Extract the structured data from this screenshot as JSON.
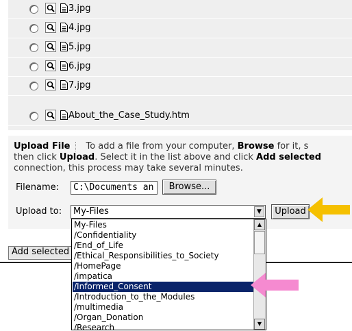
{
  "files": [
    {
      "name": "3.jpg"
    },
    {
      "name": "4.jpg"
    },
    {
      "name": "5.jpg"
    },
    {
      "name": "6.jpg"
    },
    {
      "name": "7.jpg"
    },
    {
      "name": "About_the_Case_Study.htm"
    }
  ],
  "upload": {
    "title": "Upload File",
    "help_line1_text": "To add a file from your computer,",
    "help_browse": "Browse",
    "help_line1_tail": "for it, s",
    "help_line2_lead": "then click",
    "help_upload": "Upload",
    "help_line2_mid": ". Select it in the list above and click",
    "help_add_selected": "Add selected",
    "help_line3": "connection, this process may take several minutes.",
    "filename_label": "Filename:",
    "filename_value": "C:\\Documents an",
    "browse_button": "Browse...",
    "upload_to_label": "Upload to:",
    "upload_to_value": "My-Files",
    "upload_button": "Upload"
  },
  "dropdown": {
    "options": [
      "My-Files",
      "/Confidentiality",
      "/End_of_Life",
      "/Ethical_Responsibilities_to_Society",
      "/HomePage",
      "/impatica",
      "/Informed_Consent",
      "/Introduction_to_the_Modules",
      "/multimedia",
      "/Organ_Donation",
      "/Research"
    ],
    "selected_index": 6
  },
  "add_selected_button": "Add selected",
  "colors": {
    "annotation_arrow_yellow": "#f5c000",
    "annotation_arrow_pink": "#f58ad0",
    "selection": "#0a246a"
  }
}
